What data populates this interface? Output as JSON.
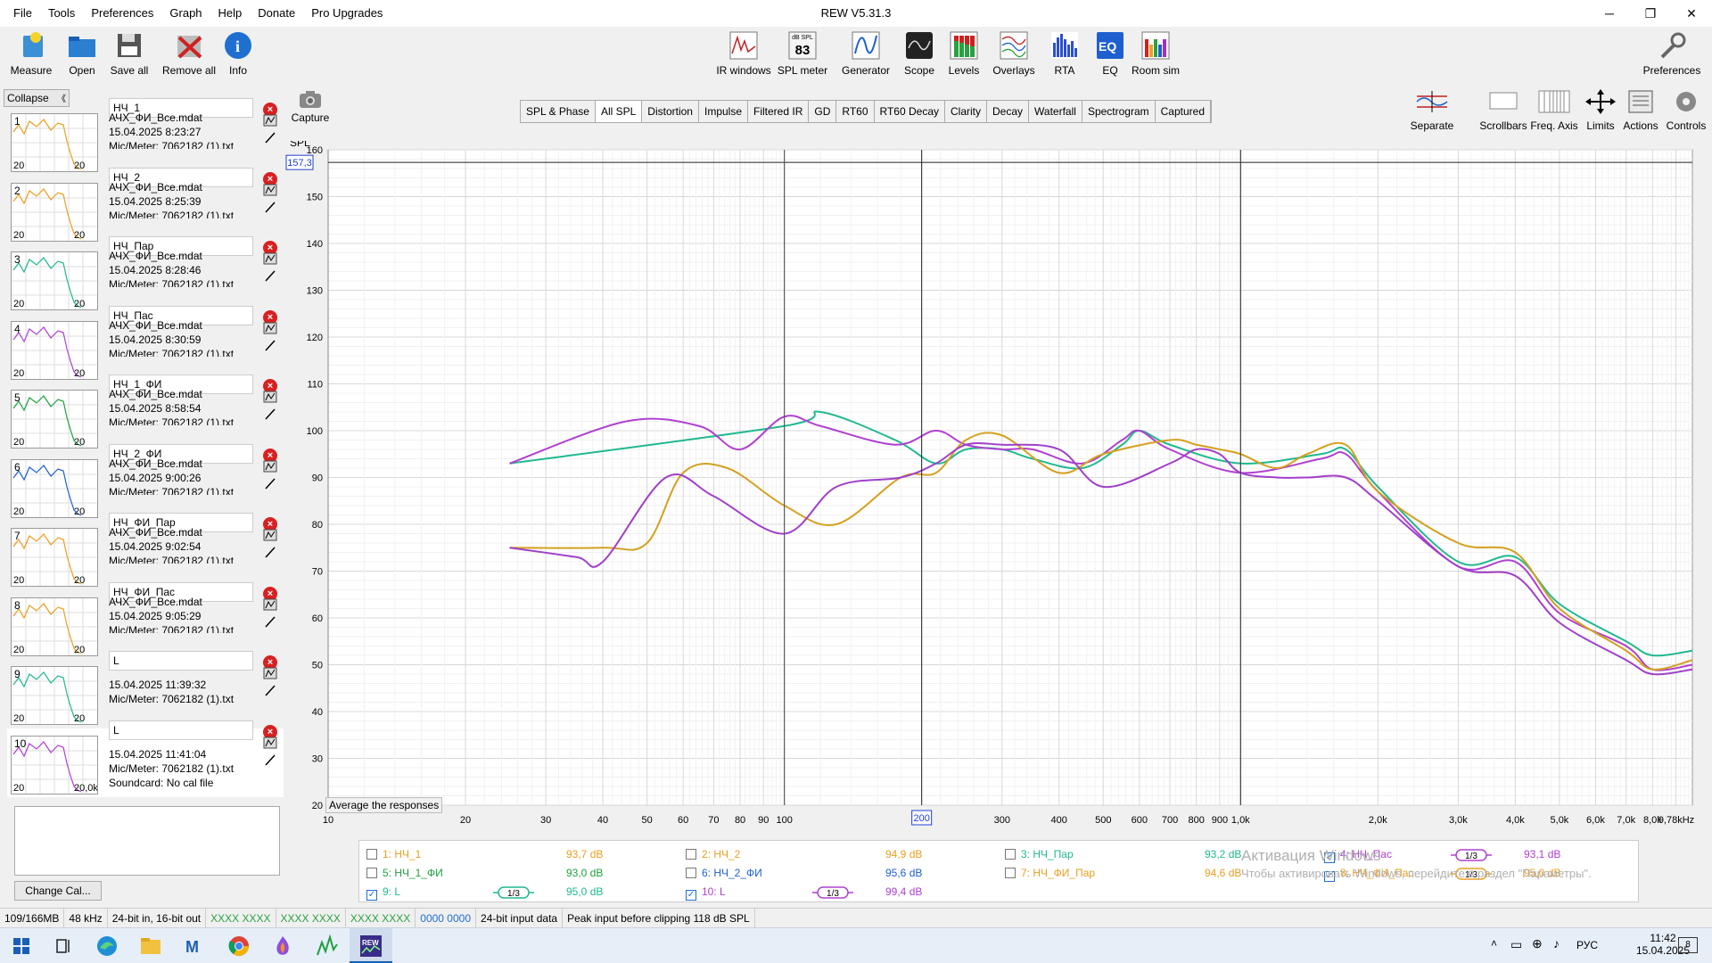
{
  "window": {
    "title": "REW V5.31.3",
    "minimize": "─",
    "maximize": "❐",
    "close": "✕"
  },
  "menus": [
    "File",
    "Tools",
    "Preferences",
    "Graph",
    "Help",
    "Donate",
    "Pro Upgrades"
  ],
  "toolbar_left": [
    {
      "label": "Measure",
      "icon": "microphone-icon"
    },
    {
      "label": "Open",
      "icon": "folder-icon"
    },
    {
      "label": "Save all",
      "icon": "floppy-icon"
    },
    {
      "label": "Remove all",
      "icon": "remove-all-icon"
    },
    {
      "label": "Info",
      "icon": "info-icon"
    }
  ],
  "toolbar_center": [
    {
      "label": "IR windows",
      "icon": "ir-windows-icon"
    },
    {
      "label": "SPL meter",
      "icon": "spl-meter-icon",
      "badge_top": "dB SPL",
      "badge_value": "83"
    },
    {
      "label": "Generator",
      "icon": "sine-generator-icon"
    },
    {
      "label": "Scope",
      "icon": "scope-icon"
    },
    {
      "label": "Levels",
      "icon": "levels-icon"
    },
    {
      "label": "Overlays",
      "icon": "overlays-icon"
    },
    {
      "label": "RTA",
      "icon": "rta-icon"
    },
    {
      "label": "EQ",
      "icon": "eq-icon"
    },
    {
      "label": "Room sim",
      "icon": "room-sim-icon"
    }
  ],
  "preferences_label": "Preferences",
  "sidebar": {
    "collapse_label": "Collapse",
    "collapse_arrows": "《",
    "change_cal_label": "Change Cal...",
    "measurements": [
      {
        "num": "1",
        "name": "НЧ_1",
        "file": "АЧХ_ФИ_Все.mdat",
        "date": "15.04.2025 8:23:27",
        "mic": "Mic/Meter: 7062182 (1).txt",
        "color": "#e8a020"
      },
      {
        "num": "2",
        "name": "НЧ_2",
        "file": "АЧХ_ФИ_Все.mdat",
        "date": "15.04.2025 8:25:39",
        "mic": "Mic/Meter: 7062182 (1).txt",
        "color": "#e8a020"
      },
      {
        "num": "3",
        "name": "НЧ_Пар",
        "file": "АЧХ_ФИ_Все.mdat",
        "date": "15.04.2025 8:28:46",
        "mic": "Mic/Meter: 7062182 (1).txt",
        "color": "#20b890"
      },
      {
        "num": "4",
        "name": "НЧ_Пас",
        "file": "АЧХ_ФИ_Все.mdat",
        "date": "15.04.2025 8:30:59",
        "mic": "Mic/Meter: 7062182 (1).txt",
        "color": "#b040d0"
      },
      {
        "num": "5",
        "name": "НЧ_1_ФИ",
        "file": "АЧХ_ФИ_Все.mdat",
        "date": "15.04.2025 8:58:54",
        "mic": "Mic/Meter: 7062182 (1).txt",
        "color": "#20a040"
      },
      {
        "num": "6",
        "name": "НЧ_2_ФИ",
        "file": "АЧХ_ФИ_Все.mdat",
        "date": "15.04.2025 9:00:26",
        "mic": "Mic/Meter: 7062182 (1).txt",
        "color": "#2060d0"
      },
      {
        "num": "7",
        "name": "НЧ_ФИ_Пар",
        "file": "АЧХ_ФИ_Все.mdat",
        "date": "15.04.2025 9:02:54",
        "mic": "Mic/Meter: 7062182 (1).txt",
        "color": "#e8a020"
      },
      {
        "num": "8",
        "name": "НЧ_ФИ_Пас",
        "file": "АЧХ_ФИ_Все.mdat",
        "date": "15.04.2025 9:05:29",
        "mic": "Mic/Meter: 7062182 (1).txt",
        "color": "#e8a020"
      },
      {
        "num": "9",
        "name": "L",
        "file": "",
        "date": "15.04.2025 11:39:32",
        "mic": "Mic/Meter: 7062182 (1).txt",
        "color": "#20b890"
      },
      {
        "num": "10",
        "name": "L",
        "file": "",
        "date": "15.04.2025 11:41:04",
        "mic": "Mic/Meter: 7062182 (1).txt",
        "soundcard": "Soundcard: No cal file",
        "color": "#b040d0"
      }
    ],
    "thumb_tick_left": "20",
    "thumb_tick_right": "20",
    "thumb_tick_right_last": "20,0k"
  },
  "capture_label": "Capture",
  "tabs": [
    "SPL & Phase",
    "All SPL",
    "Distortion",
    "Impulse",
    "Filtered IR",
    "GD",
    "RT60",
    "RT60 Decay",
    "Clarity",
    "Decay",
    "Waterfall",
    "Spectrogram",
    "Captured"
  ],
  "active_tab": "All SPL",
  "right_tools": [
    {
      "label": "Separate",
      "icon": "separate-icon"
    },
    {
      "label": "Scrollbars",
      "icon": "scrollbars-icon"
    },
    {
      "label": "Freq. Axis",
      "icon": "freq-axis-icon"
    },
    {
      "label": "Limits",
      "icon": "limits-icon"
    },
    {
      "label": "Actions",
      "icon": "actions-icon"
    },
    {
      "label": "Controls",
      "icon": "gear-icon"
    }
  ],
  "average_button": "Average the responses",
  "chart_data": {
    "type": "line",
    "ylabel": "SPL",
    "ylim": [
      20,
      160
    ],
    "xlim": [
      10,
      9780
    ],
    "xscale": "log",
    "y_ticks": [
      20,
      30,
      40,
      50,
      60,
      70,
      80,
      90,
      100,
      110,
      120,
      130,
      140,
      150,
      160
    ],
    "x_ticks": [
      {
        "v": 10,
        "t": "10"
      },
      {
        "v": 20,
        "t": "20"
      },
      {
        "v": 30,
        "t": "30"
      },
      {
        "v": 40,
        "t": "40"
      },
      {
        "v": 50,
        "t": "50"
      },
      {
        "v": 60,
        "t": "60"
      },
      {
        "v": 70,
        "t": "70"
      },
      {
        "v": 80,
        "t": "80"
      },
      {
        "v": 90,
        "t": "90"
      },
      {
        "v": 100,
        "t": "100"
      },
      {
        "v": 300,
        "t": "300"
      },
      {
        "v": 400,
        "t": "400"
      },
      {
        "v": 500,
        "t": "500"
      },
      {
        "v": 600,
        "t": "600"
      },
      {
        "v": 700,
        "t": "700"
      },
      {
        "v": 800,
        "t": "800"
      },
      {
        "v": 900,
        "t": "900"
      },
      {
        "v": 1000,
        "t": "1,0k"
      },
      {
        "v": 2000,
        "t": "2,0k"
      },
      {
        "v": 3000,
        "t": "3,0k"
      },
      {
        "v": 4000,
        "t": "4,0k"
      },
      {
        "v": 5000,
        "t": "5,0k"
      },
      {
        "v": 6000,
        "t": "6,0k"
      },
      {
        "v": 7000,
        "t": "7,0k"
      },
      {
        "v": 8000,
        "t": "8,0k"
      },
      {
        "v": 9780,
        "t": "9,78kHz"
      }
    ],
    "cursor": {
      "x": 200,
      "x_label": "200",
      "y": 157.3,
      "y_label": "157,3"
    },
    "grid": true,
    "series": [
      {
        "color": "#20b890",
        "x": [
          25,
          100,
          120,
          175,
          215,
          250,
          300,
          350,
          450,
          550,
          600,
          700,
          1000,
          1500,
          1700,
          2000,
          3000,
          4000,
          5000,
          7000,
          8000,
          9780
        ],
        "y": [
          93,
          101,
          104,
          98,
          93,
          96,
          96,
          94,
          92,
          97,
          100,
          97,
          93,
          95,
          96,
          88,
          72,
          73,
          63,
          55,
          52,
          53
        ]
      },
      {
        "color": "#b040d0",
        "x": [
          25,
          45,
          65,
          80,
          100,
          120,
          175,
          215,
          250,
          300,
          350,
          450,
          550,
          600,
          700,
          1000,
          1500,
          1700,
          2000,
          3000,
          4000,
          5000,
          7000,
          8000,
          9780
        ],
        "y": [
          93,
          102,
          101,
          96,
          103,
          101,
          97,
          100,
          97,
          96,
          96,
          93,
          98,
          100,
          96,
          91,
          94,
          95,
          87,
          71,
          72,
          61,
          54,
          49,
          50
        ]
      },
      {
        "color": "#d4a020",
        "x": [
          25,
          40,
          50,
          60,
          75,
          100,
          130,
          180,
          215,
          250,
          300,
          400,
          500,
          700,
          800,
          900,
          1000,
          1200,
          1400,
          1700,
          2000,
          3000,
          4000,
          5000,
          7000,
          8000,
          9780
        ],
        "y": [
          75,
          75,
          76,
          91,
          92,
          84,
          80,
          90,
          91,
          98,
          99,
          91,
          95,
          98,
          97,
          96,
          95,
          92,
          95,
          97,
          87,
          76,
          74,
          62,
          53,
          49,
          51
        ]
      },
      {
        "color": "#a040c8",
        "x": [
          25,
          35,
          40,
          55,
          70,
          100,
          130,
          180,
          215,
          250,
          300,
          400,
          500,
          700,
          800,
          900,
          1000,
          1200,
          1400,
          1700,
          2000,
          3000,
          4000,
          5000,
          7000,
          8000,
          9780
        ],
        "y": [
          75,
          73,
          72,
          90,
          86,
          78,
          88,
          90,
          93,
          97,
          97,
          96,
          88,
          93,
          96,
          95,
          91,
          90,
          90,
          90,
          85,
          71,
          69,
          59,
          51,
          48,
          49
        ]
      }
    ]
  },
  "legend": {
    "rows": [
      [
        {
          "label": "1: НЧ_1",
          "value": "93,7 dB",
          "checked": false,
          "color": "#e8a020"
        },
        {
          "label": "2: НЧ_2",
          "value": "94,9 dB",
          "checked": false,
          "color": "#e8a020"
        },
        {
          "label": "3: НЧ_Пар",
          "value": "93,2 dB",
          "checked": false,
          "color": "#20b890"
        },
        {
          "label": "4: НЧ_Пас",
          "value": "93,1 dB",
          "checked": true,
          "color": "#b040d0"
        }
      ],
      [
        {
          "label": "5: НЧ_1_ФИ",
          "value": "93,0 dB",
          "checked": false,
          "color": "#20a040"
        },
        {
          "label": "6: НЧ_2_ФИ",
          "value": "95,6 dB",
          "checked": false,
          "color": "#2060d0"
        },
        {
          "label": "7: НЧ_ФИ_Пар",
          "value": "94,6 dB",
          "checked": false,
          "color": "#e8a020"
        },
        {
          "label": "8: НЧ_ФИ_Пас",
          "value": "95,0 dB",
          "checked": true,
          "color": "#e8a020"
        }
      ],
      [
        {
          "label": "9: L",
          "value": "95,0 dB",
          "checked": true,
          "color": "#20b890"
        },
        {
          "label": "10: L",
          "value": "99,4 dB",
          "checked": true,
          "color": "#b040d0"
        }
      ]
    ],
    "smoothing_label": "1/3"
  },
  "watermark": {
    "line1": "Активация Windows",
    "line2": "Чтобы активировать Windows, перейдите в раздел \"Параметры\"."
  },
  "status": [
    "109/166MB",
    "48 kHz",
    "24-bit in, 16-bit out",
    "XXXX XXXX",
    "XXXX XXXX",
    "XXXX XXXX",
    "0000 0000",
    "24-bit input data",
    "Peak input before clipping 118 dB SPL"
  ],
  "taskbar": {
    "time": "11:42",
    "date": "15.04.2025",
    "lang": "РУС",
    "notif_count": "8"
  }
}
